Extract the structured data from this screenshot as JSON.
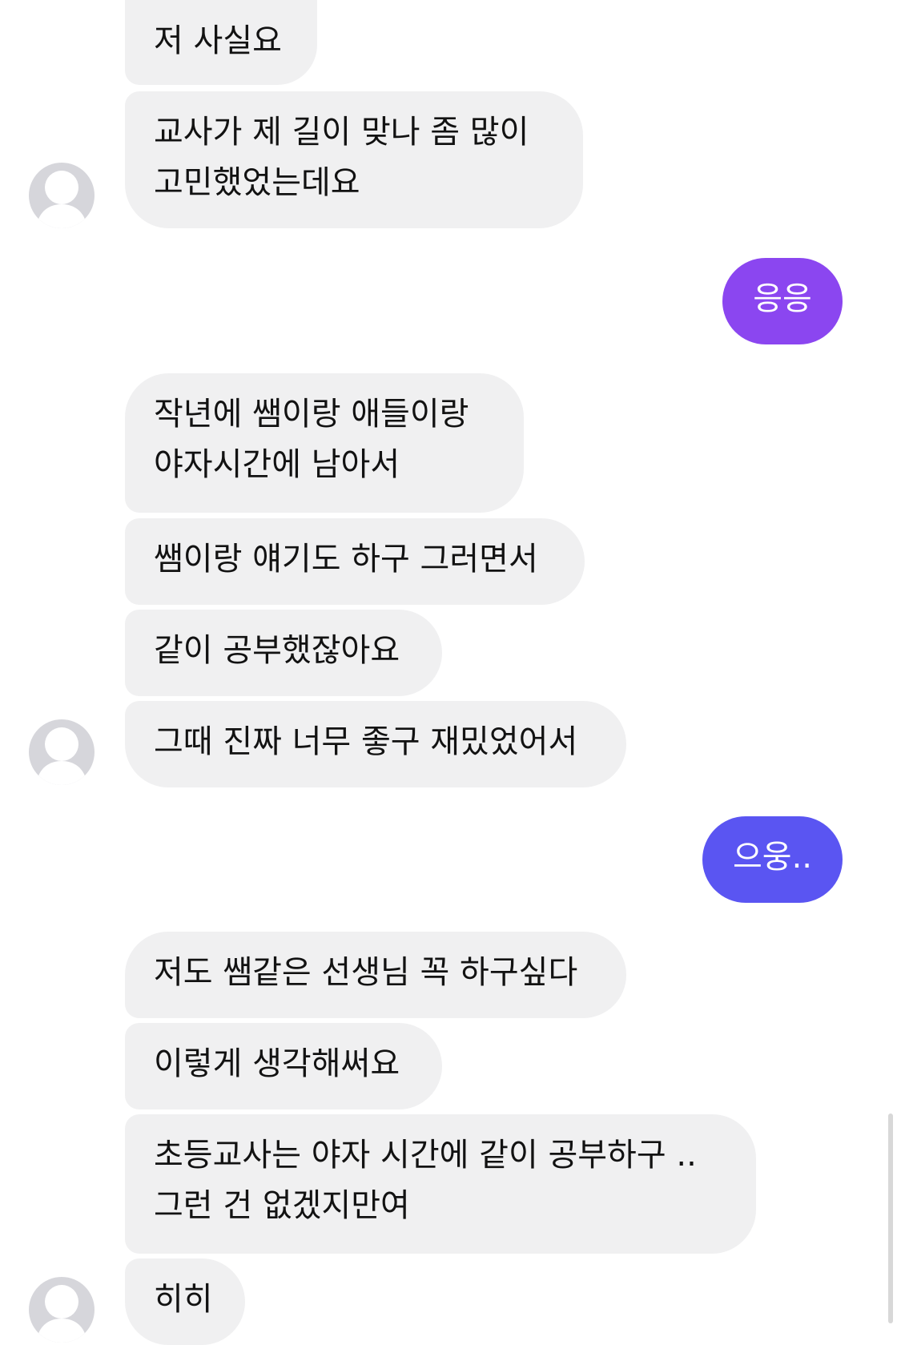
{
  "chat": {
    "incoming_bg": "#f0f0f1",
    "outgoing_colors": [
      "#8b46f0",
      "#5a55f2"
    ],
    "avatar_icon": "default-user-icon",
    "messages": [
      {
        "dir": "in",
        "lines": [
          "저 사실요"
        ]
      },
      {
        "dir": "in",
        "lines": [
          "교사가 제 길이 맞나 좀 많이",
          "고민했었는데요"
        ]
      },
      {
        "dir": "out",
        "lines": [
          "응응"
        ]
      },
      {
        "dir": "in",
        "lines": [
          "작년에 쌤이랑 애들이랑",
          "야자시간에 남아서"
        ]
      },
      {
        "dir": "in",
        "lines": [
          "쌤이랑 얘기도 하구 그러면서"
        ]
      },
      {
        "dir": "in",
        "lines": [
          "같이 공부했잖아요"
        ]
      },
      {
        "dir": "in",
        "lines": [
          "그때 진짜 너무 좋구 재밌었어서"
        ]
      },
      {
        "dir": "out",
        "lines": [
          "으웅.."
        ]
      },
      {
        "dir": "in",
        "lines": [
          "저도 쌤같은 선생님 꼭 하구싶다"
        ]
      },
      {
        "dir": "in",
        "lines": [
          "이렇게 생각해써요"
        ]
      },
      {
        "dir": "in",
        "lines": [
          "초등교사는 야자 시간에 같이 공부하구 ..",
          "그런 건 없겠지만여"
        ]
      },
      {
        "dir": "in",
        "lines": [
          "히히"
        ]
      }
    ]
  }
}
